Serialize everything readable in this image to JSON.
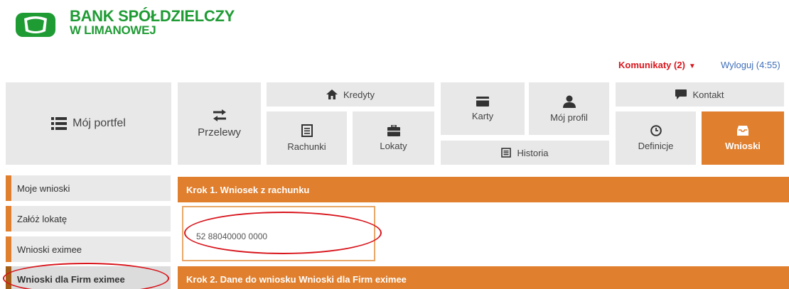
{
  "header": {
    "brand_line1": "BANK SPÓŁDZIELCZY",
    "brand_line2": "W LIMANOWEJ",
    "brand_color": "#1f9b34"
  },
  "top_links": {
    "komunikaty": "Komunikaty (2)",
    "wyloguj": "Wyloguj (4:55)",
    "accent_color": "#d8151c",
    "link_color": "#3f6fba"
  },
  "nav": {
    "moj_portfel": "Mój portfel",
    "przelewy": "Przelewy",
    "kredyty": "Kredyty",
    "rachunki": "Rachunki",
    "lokaty": "Lokaty",
    "karty": "Karty",
    "moj_profil": "Mój profil",
    "historia": "Historia",
    "kontakt": "Kontakt",
    "definicje": "Definicje",
    "wnioski": "Wnioski",
    "active_color": "#e07f2e",
    "icons": {
      "moj_portfel": "list-icon",
      "przelewy": "transfer-arrows-icon",
      "kredyty": "home-icon",
      "rachunki": "document-icon",
      "lokaty": "briefcase-icon",
      "karty": "card-icon",
      "moj_profil": "user-icon",
      "historia": "history-document-icon",
      "kontakt": "chat-icon",
      "definicje": "clock-icon",
      "wnioski": "inbox-icon"
    }
  },
  "sidebar": {
    "items": [
      {
        "label": "Moje wnioski"
      },
      {
        "label": "Załóż lokatę"
      },
      {
        "label": "Wnioski eximee"
      },
      {
        "label": "Wnioski dla Firm eximee"
      }
    ]
  },
  "main": {
    "step1_title": "Krok 1. Wniosek z rachunku",
    "account_number": "52 88040000 0000",
    "step2_title": "Krok 2. Dane do wniosku Wnioski dla Firm eximee"
  }
}
